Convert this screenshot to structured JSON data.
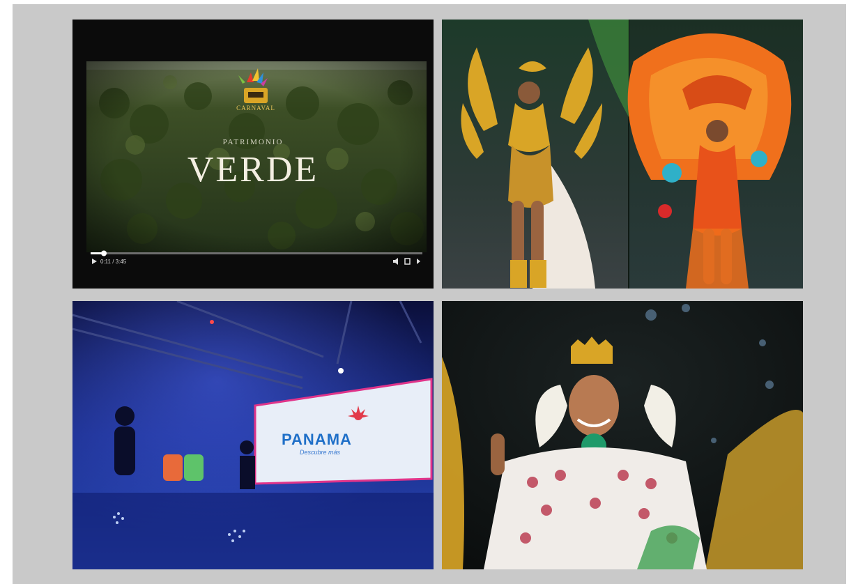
{
  "video": {
    "logo_text": "CARNAVAL",
    "overline": "PATRIMONIO",
    "title": "VERDE",
    "time_display": "0:11 / 3:45",
    "progress": 0.04
  },
  "concert": {
    "screen_text": "PANAMA",
    "screen_subtext": "Descubre más"
  },
  "colors": {
    "frame": "#c9c9c9",
    "forest": "#3e5128",
    "gold": "#d9a526",
    "orange": "#f0701c",
    "stage_blue": "#1b2e8c"
  }
}
